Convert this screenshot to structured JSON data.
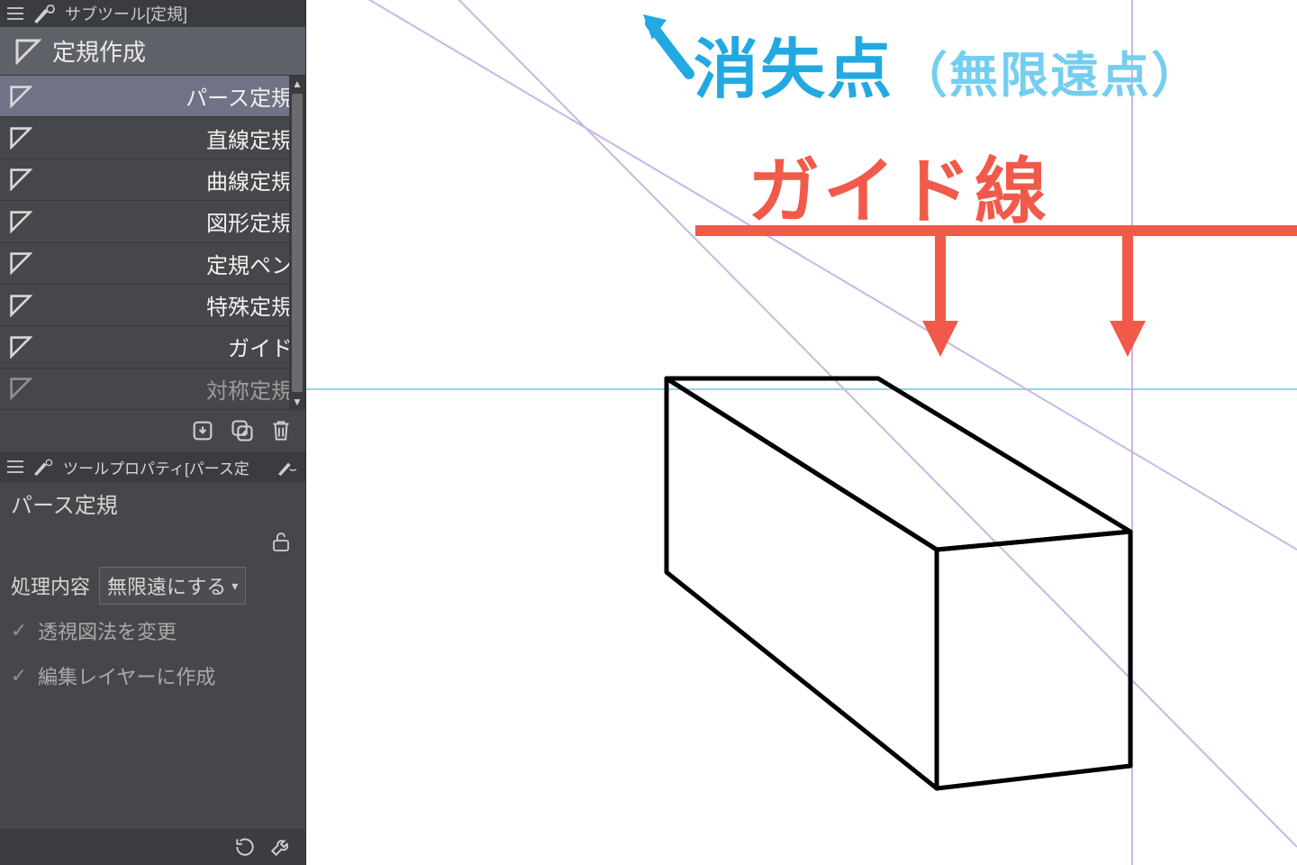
{
  "colors": {
    "accent_blue": "#23a9e1",
    "accent_blue_light": "#74cef0",
    "accent_red": "#f15a4a",
    "guide_purple": "#b6a1d6",
    "horizon_cyan": "#8fd6e8"
  },
  "subtool_panel": {
    "header_title": "サブツール[定規]",
    "group_tab": "定規作成",
    "items": [
      {
        "label": "パース定規",
        "selected": true
      },
      {
        "label": "直線定規"
      },
      {
        "label": "曲線定規"
      },
      {
        "label": "図形定規"
      },
      {
        "label": "定規ペン"
      },
      {
        "label": "特殊定規"
      },
      {
        "label": "ガイド"
      },
      {
        "label": "対称定規"
      }
    ]
  },
  "tool_property": {
    "header_title": "ツールプロパティ[パース定",
    "title": "パース定規",
    "process_label": "処理内容",
    "process_value": "無限遠にする",
    "checks": [
      "透視図法を変更",
      "編集レイヤーに作成"
    ]
  },
  "annotations": {
    "vanishing_point": "消失点",
    "vanishing_point_paren": "（無限遠点）",
    "guide_line": "ガイド線"
  }
}
